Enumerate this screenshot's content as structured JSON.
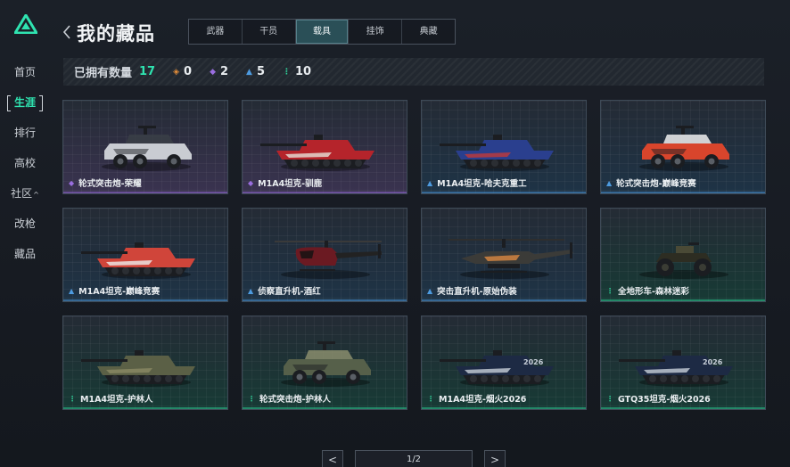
{
  "sidebar": {
    "items": [
      {
        "label": "首页",
        "active": false
      },
      {
        "label": "生涯",
        "active": true
      },
      {
        "label": "排行",
        "active": false
      },
      {
        "label": "高校",
        "active": false
      },
      {
        "label": "社区",
        "active": false,
        "caret": "^"
      },
      {
        "label": "改枪",
        "active": false
      },
      {
        "label": "藏品",
        "active": false
      }
    ]
  },
  "header": {
    "title": "我的藏品",
    "tabs": [
      {
        "label": "武器",
        "active": false
      },
      {
        "label": "干员",
        "active": false
      },
      {
        "label": "载具",
        "active": true
      },
      {
        "label": "挂饰",
        "active": false
      },
      {
        "label": "典藏",
        "active": false
      }
    ]
  },
  "stats": {
    "label": "已拥有数量",
    "total": "17",
    "items": [
      {
        "icon": "orange-diamond-icon",
        "glyph": "◈",
        "color": "#e8903a",
        "value": "0"
      },
      {
        "icon": "purple-diamond-icon",
        "glyph": "◆",
        "color": "#9a6ee0",
        "value": "2"
      },
      {
        "icon": "blue-rank-icon",
        "glyph": "▲",
        "color": "#4d9be0",
        "value": "5"
      },
      {
        "icon": "green-rank-icon",
        "glyph": "⋮",
        "color": "#2fd39a",
        "value": "10"
      }
    ]
  },
  "items": [
    {
      "name": "轮式突击炮-荣耀",
      "rarity": "purple",
      "glyph": "◆",
      "color": "#9a6ee0",
      "bg": "#3a3350",
      "vehicle": "wheeled-assault-gun",
      "body": "#c9ccd2",
      "accent": "#3a3e47"
    },
    {
      "name": "M1A4坦克-驯鹿",
      "rarity": "purple",
      "glyph": "◆",
      "color": "#9a6ee0",
      "bg": "#3a3350",
      "vehicle": "tank",
      "body": "#b5242b",
      "accent": "#e6e1d9"
    },
    {
      "name": "M1A4坦克-哈夫克重工",
      "rarity": "blue",
      "glyph": "▲",
      "color": "#4d9be0",
      "bg": "#1e3346",
      "vehicle": "tank",
      "body": "#2a3f8e",
      "accent": "#c23a3a"
    },
    {
      "name": "轮式突击炮-巅峰竞赛",
      "rarity": "blue",
      "glyph": "▲",
      "color": "#4d9be0",
      "bg": "#1e3346",
      "vehicle": "wheeled-assault-gun",
      "body": "#d8452c",
      "accent": "#efefef"
    },
    {
      "name": "M1A4坦克-巅峰竞赛",
      "rarity": "blue",
      "glyph": "▲",
      "color": "#4d9be0",
      "bg": "#1e3346",
      "vehicle": "tank",
      "body": "#d0453a",
      "accent": "#ececec"
    },
    {
      "name": "侦察直升机-酒红",
      "rarity": "blue",
      "glyph": "▲",
      "color": "#4d9be0",
      "bg": "#1e3346",
      "vehicle": "scout-helicopter",
      "body": "#6b1a22",
      "accent": "#222222"
    },
    {
      "name": "突击直升机-原始伪装",
      "rarity": "blue",
      "glyph": "▲",
      "color": "#4d9be0",
      "bg": "#1e3346",
      "vehicle": "attack-helicopter",
      "body": "#3b3b38",
      "accent": "#c98040"
    },
    {
      "name": "全地形车-森林迷彩",
      "rarity": "green",
      "glyph": "⋮",
      "color": "#2fd39a",
      "bg": "#173a35",
      "vehicle": "atv",
      "body": "#2d2d22",
      "accent": "#4a4a36"
    },
    {
      "name": "M1A4坦克-护林人",
      "rarity": "green",
      "glyph": "⋮",
      "color": "#2fd39a",
      "bg": "#173a35",
      "vehicle": "tank",
      "body": "#5b6046",
      "accent": "#8b8a64"
    },
    {
      "name": "轮式突击炮-护林人",
      "rarity": "green",
      "glyph": "⋮",
      "color": "#2fd39a",
      "bg": "#173a35",
      "vehicle": "wheeled-assault-gun",
      "body": "#56604a",
      "accent": "#8a8d6c"
    },
    {
      "name": "M1A4坦克-烟火2026",
      "rarity": "green",
      "glyph": "⋮",
      "color": "#2fd39a",
      "bg": "#173a35",
      "vehicle": "tank",
      "body": "#1d2a44",
      "accent": "#c8cfd9",
      "decal": "2026"
    },
    {
      "name": "GTQ35坦克-烟火2026",
      "rarity": "green",
      "glyph": "⋮",
      "color": "#2fd39a",
      "bg": "#173a35",
      "vehicle": "tank",
      "body": "#1d2a44",
      "accent": "#c8cfd9",
      "decal": "2026"
    }
  ],
  "pager": {
    "prev": "<",
    "label": "1/2",
    "next": ">"
  }
}
